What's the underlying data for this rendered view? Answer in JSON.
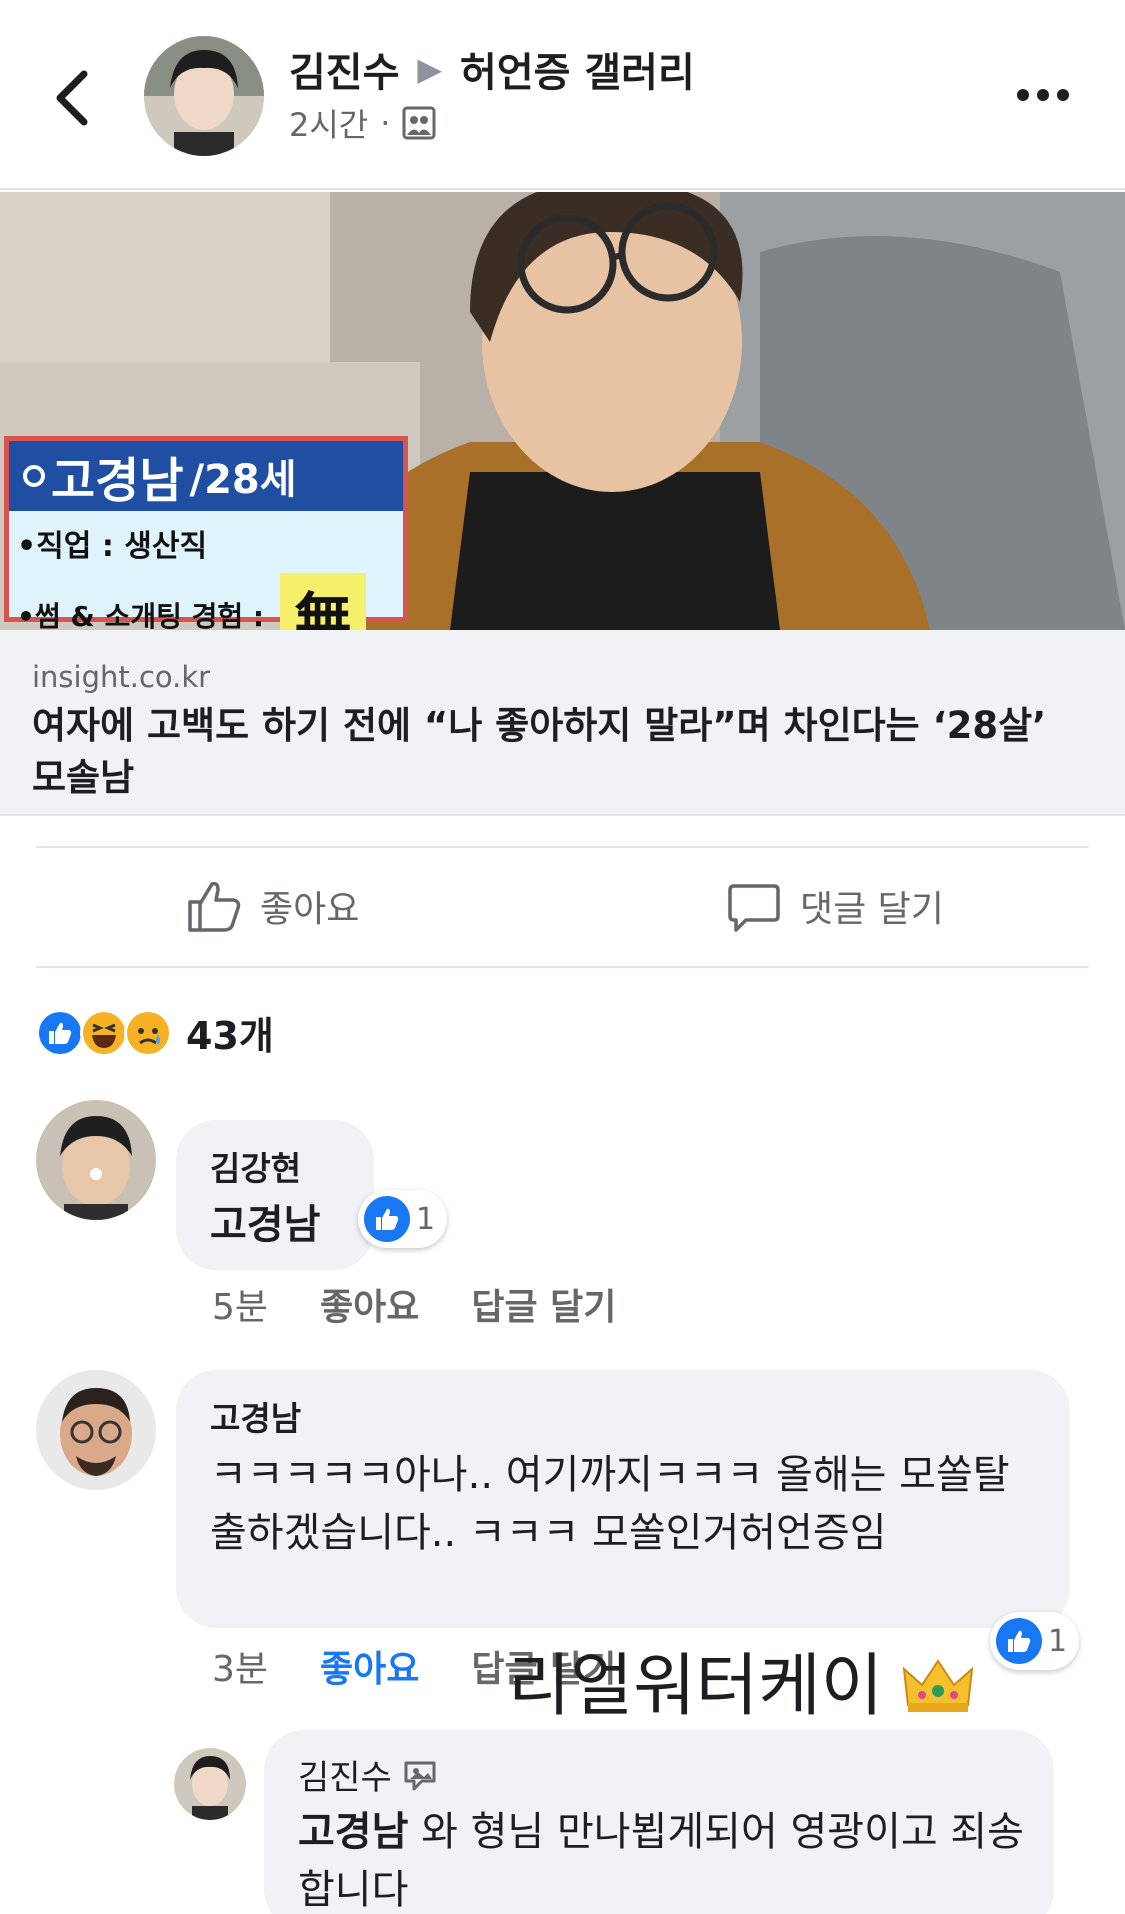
{
  "header": {
    "author": "김진수",
    "separator_icon": "triangle-right-icon",
    "group": "허언증 갤러리",
    "time": "2시간",
    "dot": "·",
    "privacy_icon": "group-icon"
  },
  "link": {
    "image_overlay": {
      "name": "고경남",
      "age": "/28세",
      "row1": "•직업 : 생산직",
      "row2": "•썸 & 소개팅 경험 :",
      "value": "無"
    },
    "domain": "insight.co.kr",
    "title": "여자에 고백도 하기 전에 “나 좋아하지 말라”며 차인다는 ‘28살’ 모솔남"
  },
  "actions": {
    "like_label": "좋아요",
    "comment_label": "댓글 달기"
  },
  "reactions": {
    "count": "43개",
    "types": [
      "like",
      "haha",
      "sad"
    ]
  },
  "comments": [
    {
      "author": "김강현",
      "text": "고경남",
      "time": "5분",
      "like_label": "좋아요",
      "reply_label": "답글 달기",
      "likes": "1"
    },
    {
      "author": "고경남",
      "text": "ㅋㅋㅋㅋㅋ아나..  여기까지ㅋㅋㅋ 올해는 모쏠탈출하겠습니다..  ㅋㅋㅋ 모쏠인거허언증임",
      "time": "3분",
      "like_label": "좋아요",
      "reply_label": "답글 달기",
      "likes": "1"
    }
  ],
  "reply": {
    "author": "김진수",
    "author_icon": "edit-photo-icon",
    "mention": "고경남",
    "text": " 와 형님 만나뵙게되어 영광이고 죄송합니다"
  },
  "overlay_text": "리얼워터케이",
  "overlay_emoji": "crown-icon",
  "colors": {
    "accent": "#1877f2",
    "bubble": "#f0f2f5",
    "muted": "#65676b"
  }
}
